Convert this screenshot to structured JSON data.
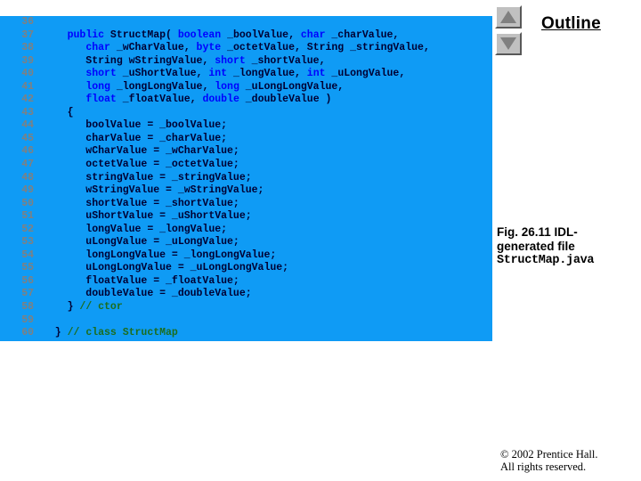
{
  "outline": {
    "heading": "Outline"
  },
  "scroll": {
    "up_icon": "triangle-up-icon",
    "down_icon": "triangle-down-icon"
  },
  "caption": {
    "line1": "Fig. 26.11 IDL-",
    "line2": "generated file",
    "filename": "StructMap.java"
  },
  "footer": {
    "line1": "© 2002 Prentice Hall.",
    "line2": "All rights reserved."
  },
  "colors": {
    "code_background": "#0f9bf5",
    "keyword": "#0000ff",
    "comment": "#1d6d1d",
    "identifier": "#000033",
    "line_number": "#808080",
    "button_face": "#c0c0c0"
  },
  "code": {
    "language": "java",
    "lines": [
      {
        "number": "36",
        "tokens": []
      },
      {
        "number": "37",
        "tokens": [
          {
            "t": "    ",
            "c": "plain"
          },
          {
            "t": "public",
            "c": "kw"
          },
          {
            "t": " StructMap( ",
            "c": "plain"
          },
          {
            "t": "boolean",
            "c": "kw"
          },
          {
            "t": " _boolValue, ",
            "c": "plain"
          },
          {
            "t": "char",
            "c": "kw"
          },
          {
            "t": " _charValue,",
            "c": "plain"
          }
        ]
      },
      {
        "number": "38",
        "tokens": [
          {
            "t": "       ",
            "c": "plain"
          },
          {
            "t": "char",
            "c": "kw"
          },
          {
            "t": " _wCharValue, ",
            "c": "plain"
          },
          {
            "t": "byte",
            "c": "kw"
          },
          {
            "t": " _octetValue, String _stringValue,",
            "c": "plain"
          }
        ]
      },
      {
        "number": "39",
        "tokens": [
          {
            "t": "       String wStringValue, ",
            "c": "plain"
          },
          {
            "t": "short",
            "c": "kw"
          },
          {
            "t": " _shortValue,",
            "c": "plain"
          }
        ]
      },
      {
        "number": "40",
        "tokens": [
          {
            "t": "       ",
            "c": "plain"
          },
          {
            "t": "short",
            "c": "kw"
          },
          {
            "t": " _uShortValue, ",
            "c": "plain"
          },
          {
            "t": "int",
            "c": "kw"
          },
          {
            "t": " _longValue, ",
            "c": "plain"
          },
          {
            "t": "int",
            "c": "kw"
          },
          {
            "t": " _uLongValue,",
            "c": "plain"
          }
        ]
      },
      {
        "number": "41",
        "tokens": [
          {
            "t": "       ",
            "c": "plain"
          },
          {
            "t": "long",
            "c": "kw"
          },
          {
            "t": " _longLongValue, ",
            "c": "plain"
          },
          {
            "t": "long",
            "c": "kw"
          },
          {
            "t": " _uLongLongValue,",
            "c": "plain"
          }
        ]
      },
      {
        "number": "42",
        "tokens": [
          {
            "t": "       ",
            "c": "plain"
          },
          {
            "t": "float",
            "c": "kw"
          },
          {
            "t": " _floatValue, ",
            "c": "plain"
          },
          {
            "t": "double",
            "c": "kw"
          },
          {
            "t": " _doubleValue )",
            "c": "plain"
          }
        ]
      },
      {
        "number": "43",
        "tokens": [
          {
            "t": "    {",
            "c": "plain"
          }
        ]
      },
      {
        "number": "44",
        "tokens": [
          {
            "t": "       boolValue = _boolValue;",
            "c": "plain"
          }
        ]
      },
      {
        "number": "45",
        "tokens": [
          {
            "t": "       charValue = _charValue;",
            "c": "plain"
          }
        ]
      },
      {
        "number": "46",
        "tokens": [
          {
            "t": "       wCharValue = _wCharValue;",
            "c": "plain"
          }
        ]
      },
      {
        "number": "47",
        "tokens": [
          {
            "t": "       octetValue = _octetValue;",
            "c": "plain"
          }
        ]
      },
      {
        "number": "48",
        "tokens": [
          {
            "t": "       stringValue = _stringValue;",
            "c": "plain"
          }
        ]
      },
      {
        "number": "49",
        "tokens": [
          {
            "t": "       wStringValue = _wStringValue;",
            "c": "plain"
          }
        ]
      },
      {
        "number": "50",
        "tokens": [
          {
            "t": "       shortValue = _shortValue;",
            "c": "plain"
          }
        ]
      },
      {
        "number": "51",
        "tokens": [
          {
            "t": "       uShortValue = _uShortValue;",
            "c": "plain"
          }
        ]
      },
      {
        "number": "52",
        "tokens": [
          {
            "t": "       longValue = _longValue;",
            "c": "plain"
          }
        ]
      },
      {
        "number": "53",
        "tokens": [
          {
            "t": "       uLongValue = _uLongValue;",
            "c": "plain"
          }
        ]
      },
      {
        "number": "54",
        "tokens": [
          {
            "t": "       longLongValue = _longLongValue;",
            "c": "plain"
          }
        ]
      },
      {
        "number": "55",
        "tokens": [
          {
            "t": "       uLongLongValue = _uLongLongValue;",
            "c": "plain"
          }
        ]
      },
      {
        "number": "56",
        "tokens": [
          {
            "t": "       floatValue = _floatValue;",
            "c": "plain"
          }
        ]
      },
      {
        "number": "57",
        "tokens": [
          {
            "t": "       doubleValue = _doubleValue;",
            "c": "plain"
          }
        ]
      },
      {
        "number": "58",
        "tokens": [
          {
            "t": "    } ",
            "c": "plain"
          },
          {
            "t": "// ctor",
            "c": "cmt"
          }
        ]
      },
      {
        "number": "59",
        "tokens": []
      },
      {
        "number": "60",
        "tokens": [
          {
            "t": "  } ",
            "c": "plain"
          },
          {
            "t": "// class StructMap",
            "c": "cmt"
          }
        ]
      }
    ]
  }
}
